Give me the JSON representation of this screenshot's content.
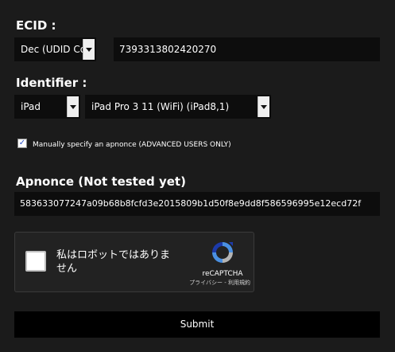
{
  "ecid": {
    "label": "ECID :",
    "format_selected": "Dec (UDID Compatible)",
    "value": "7393313802420270"
  },
  "identifier": {
    "label": "Identifier :",
    "device_type_selected": "iPad",
    "model_selected": "iPad Pro 3 11 (WiFi) (iPad8,1)"
  },
  "apnonce_toggle": {
    "checked": true,
    "label": "Manually specify an apnonce (ADVANCED USERS ONLY)"
  },
  "apnonce": {
    "label": "Apnonce (Not tested yet)",
    "value": "583633077247a09b68b8fcfd3e2015809b1d50f8e9dd8f586596995e12ecd72f"
  },
  "recaptcha": {
    "checkbox_label": "私はロボットではありません",
    "brand": "reCAPTCHA",
    "links": "プライバシー - 利用規約"
  },
  "submit": {
    "label": "Submit"
  },
  "colors": {
    "background": "#1b1b1b",
    "field_background": "#0d0d0d",
    "text": "#ffffff",
    "recaptcha_blue": "#4a90e2",
    "recaptcha_gray": "#b4b4b4"
  },
  "icons": {
    "recaptcha_logo": "recaptcha-logo-icon",
    "select_arrow": "chevron-down-icon",
    "checkbox": "checkmark-icon"
  }
}
